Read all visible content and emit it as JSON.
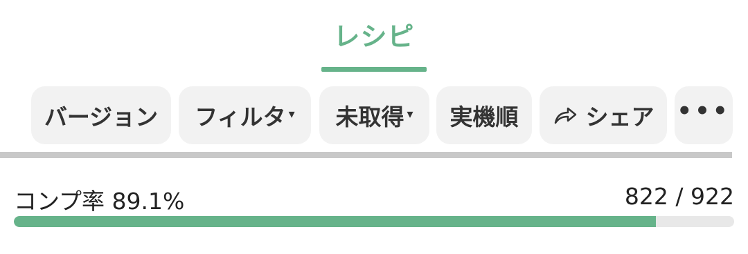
{
  "header": {
    "tab_title": "レシピ"
  },
  "toolbar": {
    "version_label": "バージョン",
    "filter_label": "フィルタ",
    "unobtained_label": "未取得",
    "sort_label": "実機順",
    "share_label": "シェア",
    "more_label": "•••",
    "caret_glyph": "▾"
  },
  "completion": {
    "label": "コンプ率 89.1%",
    "count_text": "822 / 922",
    "progress_fraction": 0.891
  },
  "colors": {
    "accent": "#66b38a",
    "chip_bg": "#f2f2f2",
    "divider": "#c8c8c8",
    "track": "#e8e8e8"
  },
  "icons": {
    "share": "share-arrow-icon",
    "more": "more-dots-icon"
  }
}
